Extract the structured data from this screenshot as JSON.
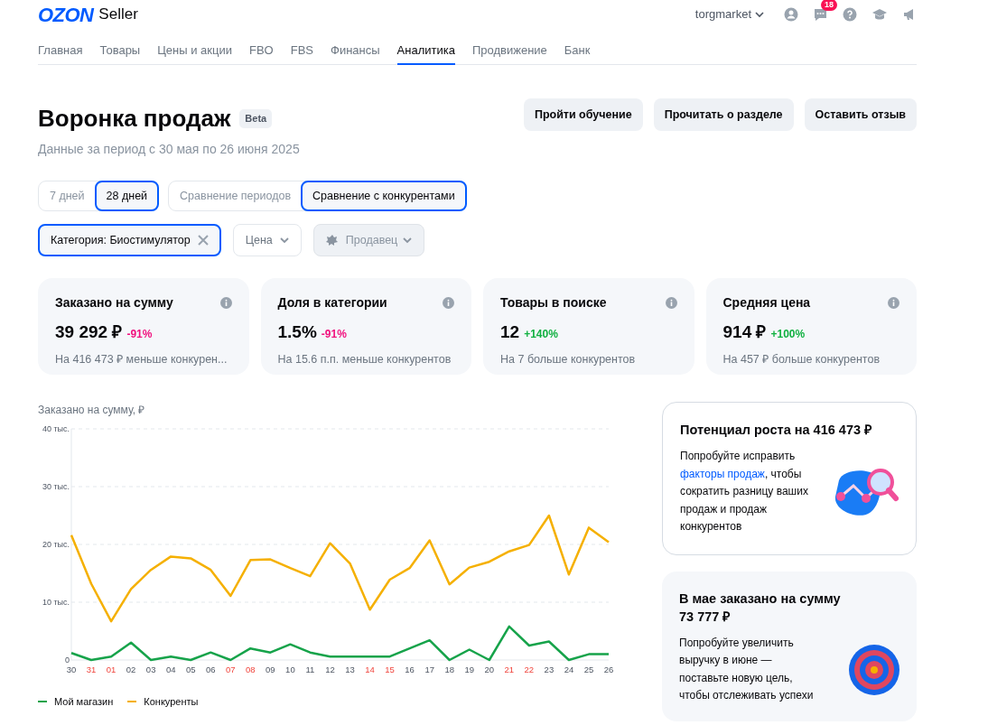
{
  "header": {
    "logo": "OZON",
    "logo_suffix": "Seller",
    "account": "torgmarket",
    "chat_badge": "18"
  },
  "nav": [
    {
      "label": "Главная",
      "selected": false
    },
    {
      "label": "Товары",
      "selected": false
    },
    {
      "label": "Цены и акции",
      "selected": false
    },
    {
      "label": "FBO",
      "selected": false
    },
    {
      "label": "FBS",
      "selected": false
    },
    {
      "label": "Финансы",
      "selected": false
    },
    {
      "label": "Аналитика",
      "selected": true
    },
    {
      "label": "Продвижение",
      "selected": false
    },
    {
      "label": "Банк",
      "selected": false
    }
  ],
  "page": {
    "title": "Воронка продаж",
    "badge": "Beta",
    "subtitle": "Данные за период с 30 мая по 26 июня 2025",
    "buttons": [
      "Пройти обучение",
      "Прочитать о разделе",
      "Оставить отзыв"
    ]
  },
  "period_toggle": [
    {
      "label": "7 дней",
      "selected": false
    },
    {
      "label": "28 дней",
      "selected": true
    }
  ],
  "compare_toggle": [
    {
      "label": "Сравнение периодов",
      "selected": false
    },
    {
      "label": "Сравнение с конкурентами",
      "selected": true
    }
  ],
  "filters": [
    {
      "kind": "chip",
      "label": "Категория: Биостимулятор",
      "disabled": false
    },
    {
      "kind": "dropdown",
      "label": "Цена",
      "disabled": false
    },
    {
      "kind": "seller",
      "label": "Продавец",
      "disabled": true
    }
  ],
  "metrics": [
    {
      "title": "Заказано на сумму",
      "value": "39 292 ₽",
      "delta": "-91%",
      "color": "#f1117e",
      "note": "На 416 473 ₽ меньше конкурен..."
    },
    {
      "title": "Доля в категории",
      "value": "1.5%",
      "delta": "-91%",
      "color": "#f1117e",
      "note": "На 15.6 п.п. меньше конкурентов"
    },
    {
      "title": "Товары в поиске",
      "value": "12",
      "delta": "+140%",
      "color": "#10b040",
      "note": "На 7 больше конкурентов"
    },
    {
      "title": "Средняя цена",
      "value": "914 ₽",
      "delta": "+100%",
      "color": "#10b040",
      "note": "На 457 ₽ больше конкурентов"
    }
  ],
  "chart_data": {
    "type": "line",
    "title": "Заказано на сумму, ₽",
    "categories": [
      "30",
      "31",
      "01",
      "02",
      "03",
      "04",
      "05",
      "06",
      "07",
      "08",
      "09",
      "10",
      "11",
      "12",
      "13",
      "14",
      "15",
      "16",
      "17",
      "18",
      "19",
      "20",
      "21",
      "22",
      "23",
      "24",
      "25",
      "26"
    ],
    "grid": true,
    "ylim": [
      0,
      40
    ],
    "yticks": [
      {
        "value": 0,
        "label": "0"
      },
      {
        "value": 10,
        "label": "10 тыс."
      },
      {
        "value": 20,
        "label": "20 тыс."
      },
      {
        "value": 30,
        "label": "30 тыс."
      },
      {
        "value": 40,
        "label": "40 тыс."
      }
    ],
    "series": [
      {
        "name": "Мой магазин",
        "color": "#16a34a",
        "values": [
          1.2,
          0,
          0.6,
          3.0,
          0,
          0.6,
          0,
          1.3,
          0,
          2.0,
          1.3,
          2.7,
          1.3,
          0.6,
          0.6,
          0.6,
          0.6,
          2.0,
          3.4,
          0,
          1.8,
          0,
          5.8,
          2.5,
          3.2,
          0,
          1.0,
          1.0
        ]
      },
      {
        "name": "Конкуренты",
        "color": "#f5b000",
        "values": [
          21.6,
          13.2,
          6.7,
          12.3,
          15.6,
          17.9,
          17.6,
          15.6,
          11.1,
          17.3,
          17.4,
          15.9,
          14.5,
          20.2,
          16.7,
          8.7,
          13.9,
          15.9,
          20.7,
          13.1,
          16.0,
          17.0,
          18.8,
          19.9,
          25.0,
          14.8,
          22.9,
          20.4
        ]
      }
    ]
  },
  "chart_weekend_labels": [
    false,
    true,
    true,
    false,
    false,
    false,
    false,
    false,
    true,
    true,
    false,
    false,
    false,
    false,
    false,
    true,
    true,
    false,
    false,
    false,
    false,
    false,
    true,
    true,
    false,
    false,
    false,
    false
  ],
  "promos": [
    {
      "kind": "growth",
      "title": "Потенциал роста на 416 473 ₽",
      "text_before": "Попробуйте исправить",
      "link": "факторы продаж",
      "text_after": ", чтобы сократить разницу ваших продаж и продаж конкурентов"
    },
    {
      "kind": "goal",
      "title": "В мае заказано на сумму 73 777 ₽",
      "text_before": "Попробуйте увеличить выручку в июне — поставьте новую цель, чтобы отслеживать успехи"
    }
  ]
}
